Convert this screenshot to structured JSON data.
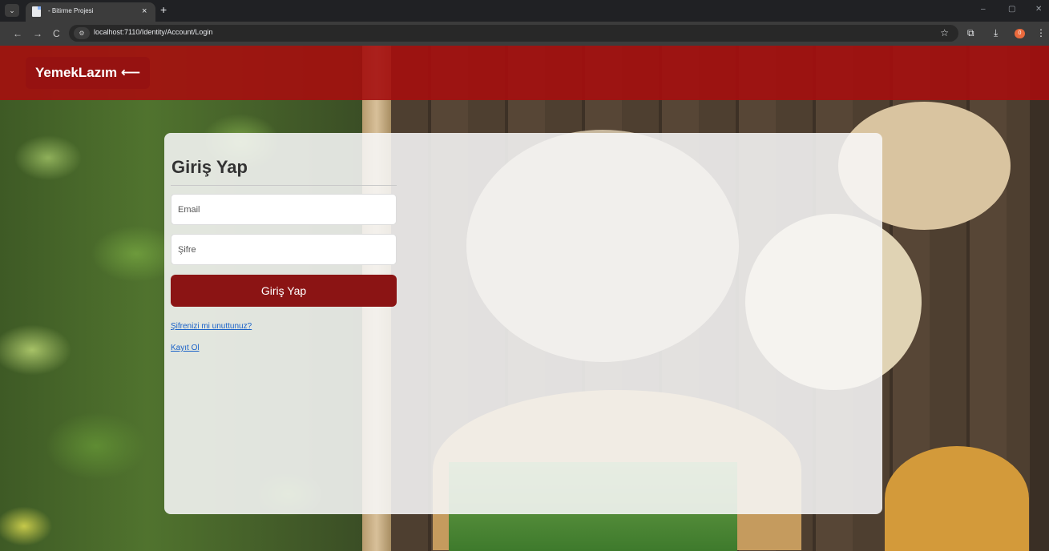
{
  "browser": {
    "tab": {
      "title": "- Bitirme Projesi",
      "close": "×"
    },
    "new_tab": "+",
    "tab_menu": "⌄",
    "window": {
      "minimize": "–",
      "maximize": "▢",
      "close": "✕"
    },
    "nav": {
      "back": "←",
      "forward": "→",
      "reload": "C"
    },
    "site_info_icon": "⚙",
    "url": "localhost:7110/Identity/Account/Login",
    "bookmark_icon": "☆",
    "extensions_icon": "⧉",
    "download_icon": "⤓",
    "profile_badge": "0",
    "menu_icon": "⋮"
  },
  "header": {
    "brand": "YemekLazım ⟵"
  },
  "login": {
    "title": "Giriş Yap",
    "email_placeholder": "Email",
    "password_placeholder": "Şifre",
    "submit": "Giriş Yap",
    "forgot_link": "Şifrenizi mi unuttunuz?",
    "register_link": "Kayıt Ol"
  },
  "colors": {
    "header": "#a50e0e",
    "button": "#8b1414",
    "link": "#1a62c8"
  }
}
